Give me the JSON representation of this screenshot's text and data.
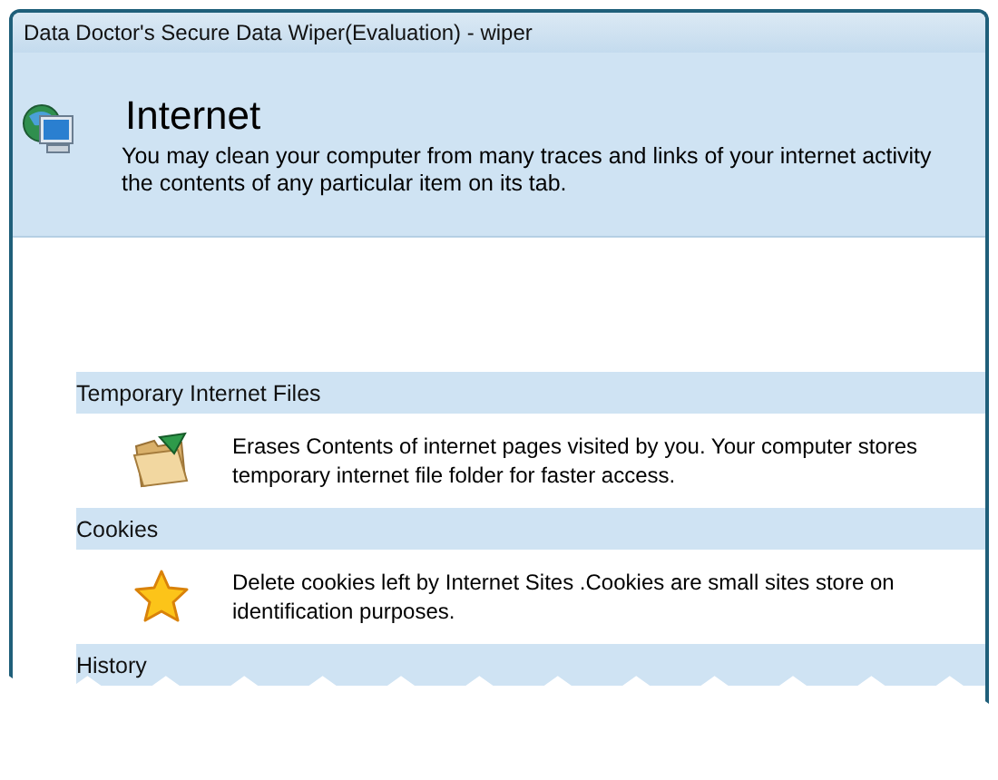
{
  "window": {
    "title": "Data Doctor's Secure Data Wiper(Evaluation) - wiper"
  },
  "header": {
    "title": "Internet",
    "description_lines": [
      "You may clean your computer from many traces and links of your internet activity",
      "the contents of any particular item on its tab."
    ]
  },
  "sections": [
    {
      "title": "Temporary Internet Files",
      "kind": "folder",
      "description_lines": [
        "Erases Contents of internet pages visited by you. Your computer stores",
        "temporary internet file folder for faster access."
      ]
    },
    {
      "title": "Cookies",
      "kind": "star",
      "description_lines": [
        "Delete cookies left by Internet Sites .Cookies are small sites store on",
        "identification purposes."
      ]
    },
    {
      "title": "History"
    }
  ]
}
